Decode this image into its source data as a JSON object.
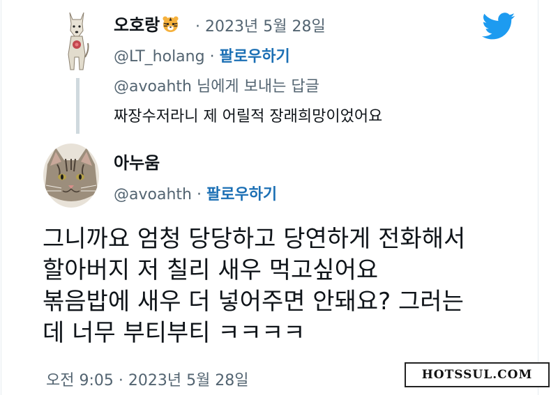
{
  "colors": {
    "text": "#0f1419",
    "muted": "#536471",
    "link": "#1b6fb4",
    "twitter_blue": "#1d9bf0",
    "thread_line": "#cfd9de"
  },
  "reply_tweet": {
    "display_name": "오호랑",
    "name_emoji": "tiger-face-icon",
    "separator": "·",
    "date": "2023년 5월 28일",
    "handle": "@LT_holang",
    "follow_label": "팔로우하기",
    "reply_to": "@avoahth 님에게 보내는 답글",
    "text": "짜장수저라니 제 어릴적 장래희망이었어요"
  },
  "main_tweet": {
    "display_name": "아누움",
    "handle": "@avoahth",
    "separator": "·",
    "follow_label": "팔로우하기",
    "text_lines": [
      "그니까요 엄청 당당하고 당연하게 전화해서",
      "할아버지 저 칠리 새우 먹고싶어요",
      "볶음밥에 새우 더 넣어주면 안돼요? 그러는",
      "데 너무 부티부티 ㅋㅋㅋㅋ"
    ],
    "timestamp": "오전 9:05 · 2023년 5월 28일"
  },
  "logo": "twitter-bird-icon",
  "watermark": "HOTSSUL.COM"
}
